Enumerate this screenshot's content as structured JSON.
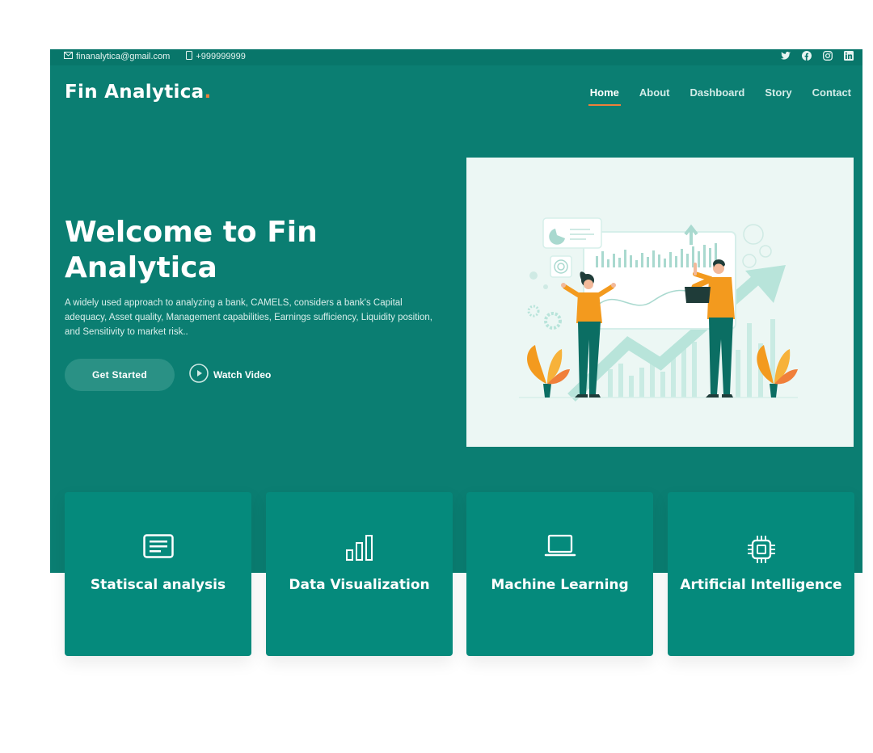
{
  "topbar": {
    "email": "finanalytica@gmail.com",
    "phone": "+999999999",
    "social_icons": [
      "twitter-icon",
      "facebook-icon",
      "instagram-icon",
      "linkedin-icon"
    ]
  },
  "brand": {
    "name": "Fin Analytica",
    "dot": "."
  },
  "nav": [
    {
      "label": "Home",
      "active": true
    },
    {
      "label": "About"
    },
    {
      "label": "Dashboard"
    },
    {
      "label": "Story"
    },
    {
      "label": "Contact"
    }
  ],
  "hero": {
    "title": "Welcome to Fin Analytica",
    "text": "A widely used approach to analyzing a bank, CAMELS, considers a bank's Capital adequacy, Asset quality, Management capabilities, Earnings sufficiency, Liquidity position, and Sensitivity to market risk..",
    "cta_label": "Get Started",
    "video_label": "Watch Video"
  },
  "features": [
    {
      "title": "Statiscal analysis",
      "icon": "document-lines-icon"
    },
    {
      "title": "Data Visualization",
      "icon": "bar-chart-icon"
    },
    {
      "title": "Machine Learning",
      "icon": "laptop-icon"
    },
    {
      "title": "Artificial Intelligence",
      "icon": "cpu-chip-icon"
    }
  ],
  "colors": {
    "primary": "#0b7e72",
    "topbar": "#08766a",
    "accent": "#f07f3a",
    "card": "#058a7c",
    "illustration_bg": "#ecf7f4"
  }
}
